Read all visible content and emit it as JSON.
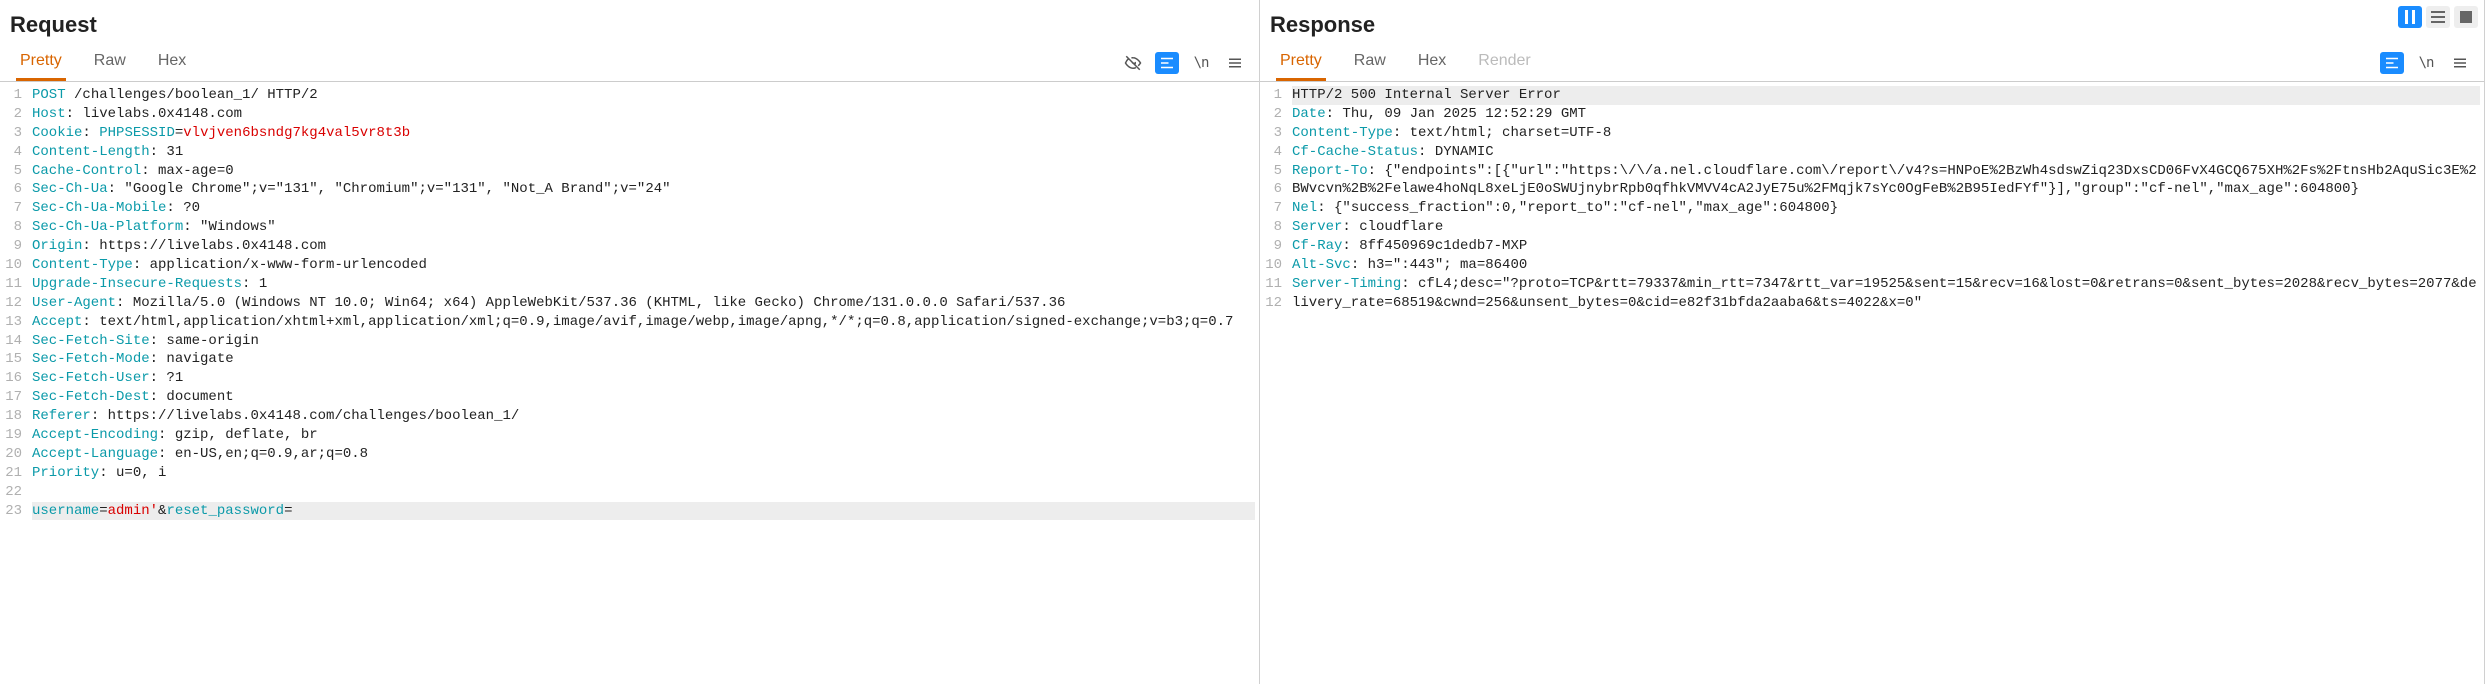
{
  "request": {
    "title": "Request",
    "tabs": {
      "pretty": "Pretty",
      "raw": "Raw",
      "hex": "Hex"
    },
    "lines": [
      {
        "n": 1,
        "html": "<span class='method'>POST</span> <span class='rl'>/challenges/boolean_1/ HTTP/2</span>"
      },
      {
        "n": 2,
        "html": "<span class='hdr'>Host</span>: livelabs.0x4148.com"
      },
      {
        "n": 3,
        "html": "<span class='ck'>Cookie</span>: <span class='ck'>PHPSESSID</span>=<span class='ckv'>vlvjven6bsndg7kg4val5vr8t3b</span>"
      },
      {
        "n": 4,
        "html": "<span class='hdr'>Content-Length</span>: 31"
      },
      {
        "n": 5,
        "html": "<span class='hdr'>Cache-Control</span>: max-age=0"
      },
      {
        "n": 6,
        "html": "<span class='hdr'>Sec-Ch-Ua</span>: \"Google Chrome\";v=\"131\", \"Chromium\";v=\"131\", \"Not_A Brand\";v=\"24\""
      },
      {
        "n": 7,
        "html": "<span class='hdr'>Sec-Ch-Ua-Mobile</span>: ?0"
      },
      {
        "n": 8,
        "html": "<span class='hdr'>Sec-Ch-Ua-Platform</span>: \"Windows\""
      },
      {
        "n": 9,
        "html": "<span class='hdr'>Origin</span>: https://livelabs.0x4148.com"
      },
      {
        "n": 10,
        "html": "<span class='hdr'>Content-Type</span>: application/x-www-form-urlencoded"
      },
      {
        "n": 11,
        "html": "<span class='hdr'>Upgrade-Insecure-Requests</span>: 1"
      },
      {
        "n": 12,
        "html": "<span class='hdr'>User-Agent</span>: Mozilla/5.0 (Windows NT 10.0; Win64; x64) AppleWebKit/537.36 (KHTML, like Gecko) Chrome/131.0.0.0 Safari/537.36"
      },
      {
        "n": 13,
        "html": "<span class='hdr'>Accept</span>: text/html,application/xhtml+xml,application/xml;q=0.9,image/avif,image/webp,image/apng,*/*;q=0.8,application/signed-exchange;v=b3;q=0.7"
      },
      {
        "n": 14,
        "html": "<span class='hdr'>Sec-Fetch-Site</span>: same-origin"
      },
      {
        "n": 15,
        "html": "<span class='hdr'>Sec-Fetch-Mode</span>: navigate"
      },
      {
        "n": 16,
        "html": "<span class='hdr'>Sec-Fetch-User</span>: ?1"
      },
      {
        "n": 17,
        "html": "<span class='hdr'>Sec-Fetch-Dest</span>: document"
      },
      {
        "n": 18,
        "html": "<span class='hdr'>Referer</span>: https://livelabs.0x4148.com/challenges/boolean_1/"
      },
      {
        "n": 19,
        "html": "<span class='hdr'>Accept-Encoding</span>: gzip, deflate, br"
      },
      {
        "n": 20,
        "html": "<span class='hdr'>Accept-Language</span>: en-US,en;q=0.9,ar;q=0.8"
      },
      {
        "n": 21,
        "html": "<span class='hdr'>Priority</span>: u=0, i"
      },
      {
        "n": 22,
        "html": ""
      },
      {
        "n": 23,
        "hl": true,
        "html": "<span class='param'>username</span>=<span class='pval'>admin'</span>&amp;<span class='param'>reset_password</span>="
      }
    ]
  },
  "response": {
    "title": "Response",
    "tabs": {
      "pretty": "Pretty",
      "raw": "Raw",
      "hex": "Hex",
      "render": "Render"
    },
    "lines": [
      {
        "n": 1,
        "hl": true,
        "html": "<span class='rl'>HTTP/2 500 Internal Server Error</span>"
      },
      {
        "n": 2,
        "html": "<span class='hdr'>Date</span>: Thu, 09 Jan 2025 12:52:29 GMT"
      },
      {
        "n": 3,
        "html": "<span class='hdr'>Content-Type</span>: text/html; charset=UTF-8"
      },
      {
        "n": 4,
        "html": "<span class='hdr'>Cf-Cache-Status</span>: DYNAMIC"
      },
      {
        "n": 5,
        "html": "<span class='hdr'>Report-To</span>: {\"endpoints\":[{\"url\":\"https:\\/\\/a.nel.cloudflare.com\\/report\\/v4?s=HNPoE%2BzWh4sdswZiq23DxsCD06FvX4GCQ675XH%2Fs%2FtnsHb2AquSic3E%2BWvcvn%2B%2Felawe4hoNqL8xeLjE0oSWUjnybrRpb0qfhkVMVV4cA2JyE75u%2FMqjk7sYc0OgFeB%2B95IedFYf\"}],\"group\":\"cf-nel\",\"max_age\":604800}"
      },
      {
        "n": 6,
        "html": "<span class='hdr'>Nel</span>: {\"success_fraction\":0,\"report_to\":\"cf-nel\",\"max_age\":604800}"
      },
      {
        "n": 7,
        "html": "<span class='hdr'>Server</span>: cloudflare"
      },
      {
        "n": 8,
        "html": "<span class='hdr'>Cf-Ray</span>: 8ff450969c1dedb7-MXP"
      },
      {
        "n": 9,
        "html": "<span class='hdr'>Alt-Svc</span>: h3=\":443\"; ma=86400"
      },
      {
        "n": 10,
        "html": "<span class='hdr'>Server-Timing</span>: cfL4;desc=\"?proto=TCP&rtt=79337&min_rtt=7347&rtt_var=19525&sent=15&recv=16&lost=0&retrans=0&sent_bytes=2028&recv_bytes=2077&delivery_rate=68519&cwnd=256&unsent_bytes=0&cid=e82f31bfda2aaba6&ts=4022&x=0\""
      },
      {
        "n": 11,
        "html": ""
      },
      {
        "n": 12,
        "html": ""
      }
    ]
  },
  "icons": {
    "slash_n": "\\n"
  }
}
